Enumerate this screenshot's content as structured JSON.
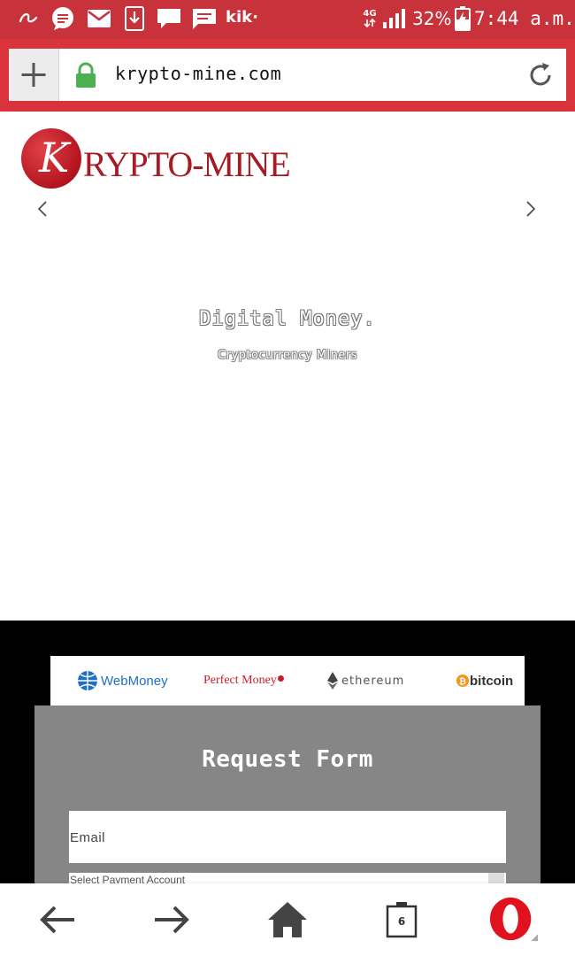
{
  "status_bar": {
    "app_icons": [
      "aliexpress-icon",
      "messages-icon",
      "gmail-icon",
      "download-icon",
      "chat-icon",
      "sms-icon"
    ],
    "kik_label": "kik·",
    "network_label": "4G",
    "battery_percent": "32%",
    "time": "7:44 a.m."
  },
  "browser": {
    "url": "krypto-mine.com",
    "tab_count": "6"
  },
  "page": {
    "logo_initial": "K",
    "logo_text": "RYPTO-MINE",
    "hero_title": "Digital Money.",
    "hero_subtitle": "Cryptocurrency Miners",
    "payment_methods": [
      {
        "name": "WebMoney",
        "color": "#1f6fc4"
      },
      {
        "name": "Perfect Money",
        "color": "#c8202a"
      },
      {
        "name": "ethereum",
        "color": "#555555"
      },
      {
        "name": "bitcoin",
        "color": "#333333"
      }
    ],
    "form": {
      "title": "Request Form",
      "email_placeholder": "Email",
      "payment_select_label": "Select Payment Account"
    }
  },
  "colors": {
    "browser_red": "#d9343c",
    "status_red": "#c8323a",
    "form_gray": "#868686",
    "brand_red": "#a51c24"
  }
}
